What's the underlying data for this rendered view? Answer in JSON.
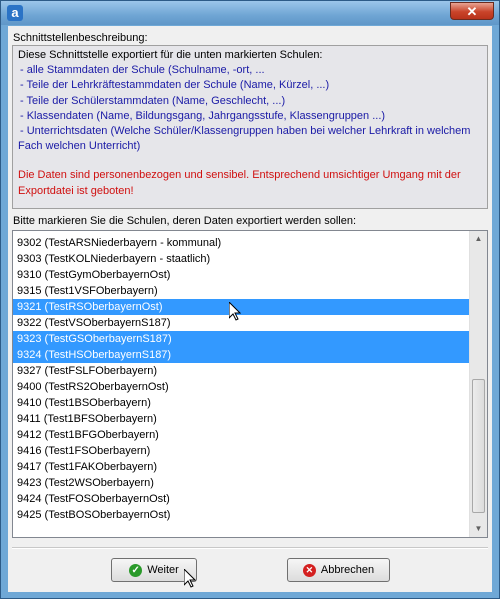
{
  "window": {
    "app_icon_letter": "a",
    "close_glyph": "✕"
  },
  "description": {
    "title": "Schnittstellenbeschreibung:",
    "intro": "Diese Schnittstelle exportiert für die unten markierten Schulen:",
    "items": [
      " - alle Stammdaten der Schule (Schulname, -ort, ...",
      " - Teile der Lehrkräftestammdaten der Schule (Name, Kürzel, ...)",
      " - Teile der Schülerstammdaten (Name, Geschlecht, ...)",
      " - Klassendaten (Name, Bildungsgang, Jahrgangsstufe, Klassengruppen ...)",
      " - Unterrichtsdaten (Welche Schüler/Klassengruppen haben bei welcher Lehrkraft in welchem",
      "Fach welchen Unterricht)"
    ],
    "warning_line1": "Die Daten sind personenbezogen und sensibel. Entsprechend umsichtiger Umgang mit der",
    "warning_line2": "Exportdatei ist geboten!"
  },
  "school_list": {
    "title": "Bitte markieren Sie die Schulen, deren Daten exportiert werden sollen:",
    "rows": [
      {
        "label": "9302 (TestARSNiederbayern - kommunal)",
        "selected": false
      },
      {
        "label": "9303 (TestKOLNiederbayern - staatlich)",
        "selected": false
      },
      {
        "label": "9310 (TestGymOberbayernOst)",
        "selected": false
      },
      {
        "label": "9315 (Test1VSFOberbayern)",
        "selected": false
      },
      {
        "label": "9321 (TestRSOberbayernOst)",
        "selected": true
      },
      {
        "label": "9322 (TestVSOberbayernS187)",
        "selected": false
      },
      {
        "label": "9323 (TestGSOberbayernS187)",
        "selected": true
      },
      {
        "label": "9324 (TestHSOberbayernS187)",
        "selected": true
      },
      {
        "label": "9327 (TestFSLFOberbayern)",
        "selected": false
      },
      {
        "label": "9400 (TestRS2OberbayernOst)",
        "selected": false
      },
      {
        "label": "9410 (Test1BSOberbayern)",
        "selected": false
      },
      {
        "label": "9411 (Test1BFSOberbayern)",
        "selected": false
      },
      {
        "label": "9412 (Test1BFGOberbayern)",
        "selected": false
      },
      {
        "label": "9416 (Test1FSOberbayern)",
        "selected": false
      },
      {
        "label": "9417 (Test1FAKOberbayern)",
        "selected": false
      },
      {
        "label": "9423 (Test2WSOberbayern)",
        "selected": false
      },
      {
        "label": "9424 (TestFOSOberbayernOst)",
        "selected": false
      },
      {
        "label": "9425 (TestBOSOberbayernOst)",
        "selected": false
      }
    ],
    "scroll_up_glyph": "▲",
    "scroll_down_glyph": "▼"
  },
  "buttons": {
    "weiter_label": "Weiter",
    "weiter_icon_glyph": "✓",
    "abbrechen_label": "Abbrechen",
    "abbrechen_icon_glyph": "✕"
  },
  "colors": {
    "selection": "#3399ff",
    "warning_text": "#d01010",
    "info_text": "#1a1aa6",
    "title_bar": "#6fa8d6"
  }
}
